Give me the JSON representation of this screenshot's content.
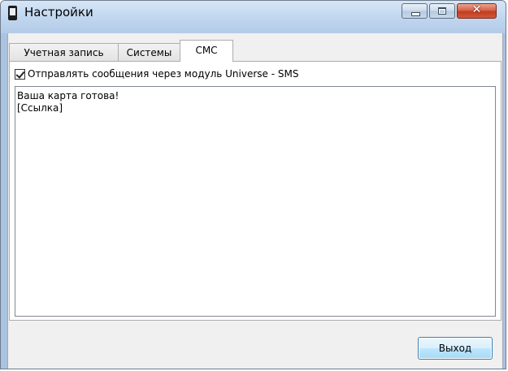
{
  "window": {
    "title": "Настройки",
    "controls": {
      "minimize_icon": "minimize-icon",
      "maximize_icon": "maximize-icon",
      "close_symbol": "✕"
    }
  },
  "tabs": [
    {
      "label": "Учетная запись",
      "active": false
    },
    {
      "label": "Системы",
      "active": false
    },
    {
      "label": "СМС",
      "active": true
    }
  ],
  "sms": {
    "checkbox_label": "Отправлять сообщения через модуль Universe - SMS",
    "checkbox_checked": true,
    "message_text": "Ваша карта готова!\n[Ссылка]"
  },
  "footer": {
    "exit_label": "Выход"
  },
  "colors": {
    "titlebar": "#c3d8f0",
    "close_button": "#c23d1f",
    "client_bg": "#f0f0f0",
    "focused_button_border": "#3c7fb1"
  }
}
